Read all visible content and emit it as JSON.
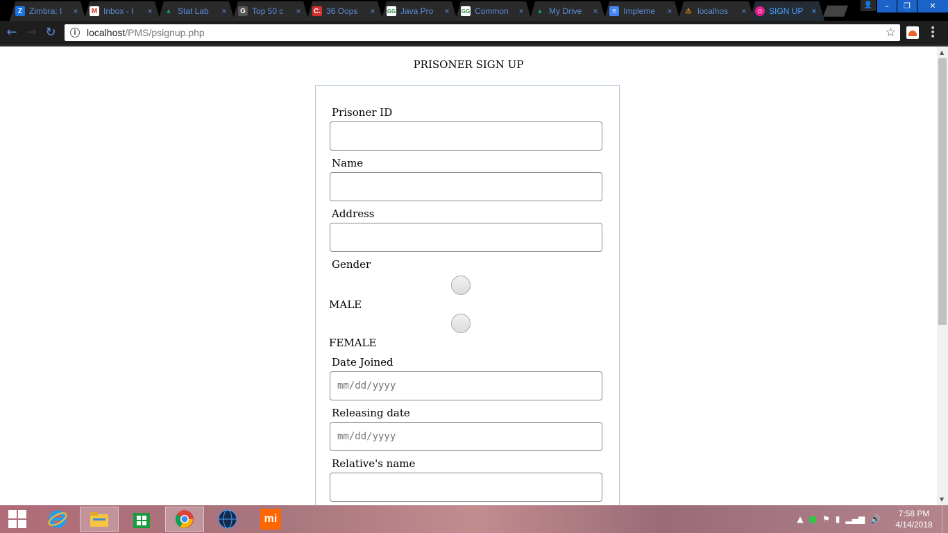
{
  "browser": {
    "tabs": [
      {
        "title": "Zimbra: I",
        "favicon_letter": "Z",
        "favicon_color": "#1a73e8"
      },
      {
        "title": "Inbox - I",
        "favicon_letter": "M",
        "favicon_color": "#d93025"
      },
      {
        "title": "Stat Lab",
        "favicon_letter": "▲",
        "favicon_color": "#0f9d58"
      },
      {
        "title": "Top 50 c",
        "favicon_letter": "G",
        "favicon_color": "#555555"
      },
      {
        "title": "36 Oops",
        "favicon_letter": "C.",
        "favicon_color": "#d32f2f"
      },
      {
        "title": "Java Pro",
        "favicon_letter": "GG",
        "favicon_color": "#2f8d46"
      },
      {
        "title": "Common",
        "favicon_letter": "GG",
        "favicon_color": "#2f8d46"
      },
      {
        "title": "My Drive",
        "favicon_letter": "▲",
        "favicon_color": "#0f9d58"
      },
      {
        "title": "Impleme",
        "favicon_letter": "≡",
        "favicon_color": "#4285f4"
      },
      {
        "title": "localhos",
        "favicon_letter": "⚠",
        "favicon_color": "#f29111"
      },
      {
        "title": "SIGN UP",
        "favicon_letter": "☺",
        "favicon_color": "#e91e8c",
        "active": true
      }
    ],
    "close_glyph": "×",
    "url_host": "localhost",
    "url_path": "/PMS/psignup.php",
    "window_buttons": {
      "minimize": "–",
      "restore": "❐",
      "close": "✕"
    }
  },
  "page": {
    "heading": "PRISONER SIGN UP",
    "fields": {
      "prisoner_id_label": "Prisoner ID",
      "name_label": "Name",
      "address_label": "Address",
      "gender_label": "Gender",
      "male_label": "MALE",
      "female_label": "FEMALE",
      "date_joined_label": "Date Joined",
      "date_joined_placeholder": "mm/dd/yyyy",
      "releasing_date_label": "Releasing date",
      "releasing_date_placeholder": "mm/dd/yyyy",
      "relatives_name_label": "Relative's name"
    }
  },
  "taskbar": {
    "time": "7:58 PM",
    "date": "4/14/2018"
  }
}
